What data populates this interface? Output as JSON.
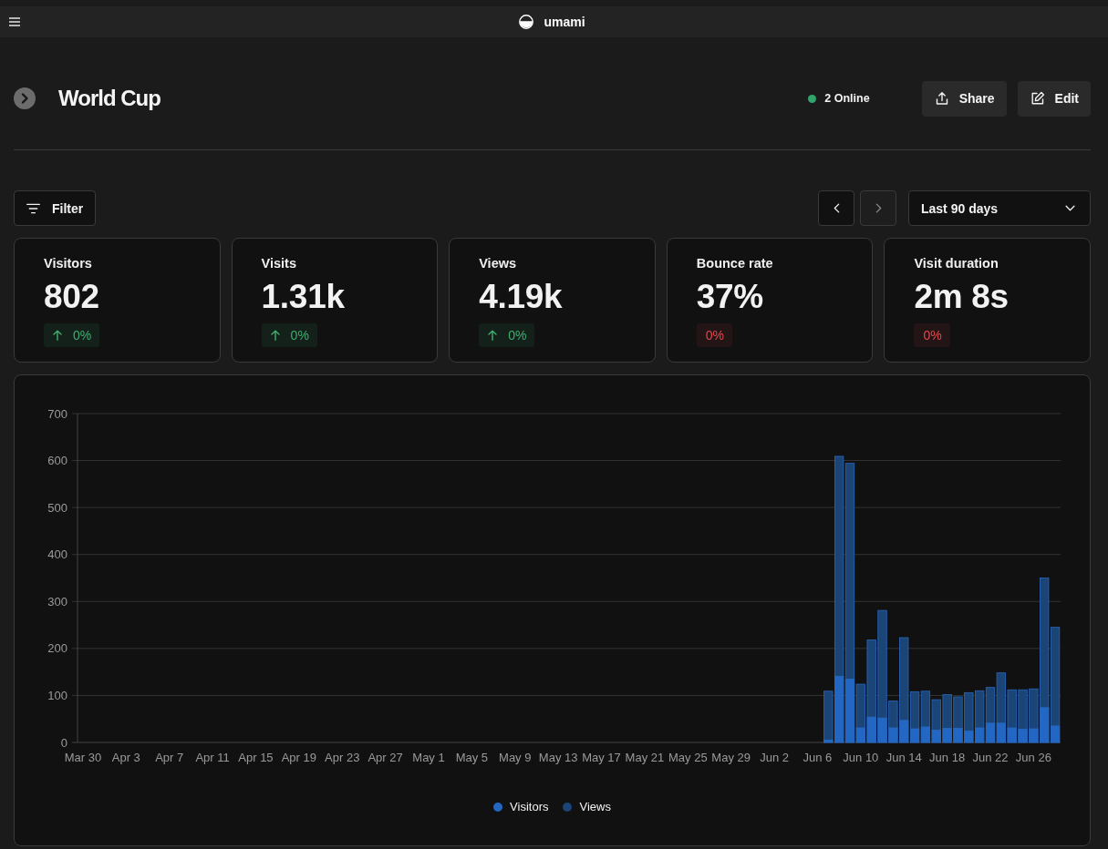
{
  "top_bar": {
    "brand": "umami"
  },
  "header": {
    "title": "World Cup",
    "online": "2 Online",
    "actions": [
      {
        "kind": "share",
        "label": "Share"
      },
      {
        "kind": "edit",
        "label": "Edit"
      }
    ]
  },
  "toolbar": {
    "filter": "Filter",
    "date_nav": [
      {
        "kind": "prev",
        "disabled": false
      },
      {
        "kind": "next",
        "disabled": true
      }
    ],
    "date_range": "Last 90 days"
  },
  "stats": [
    {
      "label": "Visitors",
      "value": "802",
      "change": {
        "text": "0%",
        "positive": true,
        "arrow_up": true
      }
    },
    {
      "label": "Visits",
      "value": "1.31k",
      "change": {
        "text": "0%",
        "positive": true,
        "arrow_up": true
      }
    },
    {
      "label": "Views",
      "value": "4.19k",
      "change": {
        "text": "0%",
        "positive": true,
        "arrow_up": true
      }
    },
    {
      "label": "Bounce rate",
      "value": "37%",
      "change": {
        "text": "0%",
        "positive": false,
        "arrow_up": false
      }
    },
    {
      "label": "Visit duration",
      "value": "2m 8s",
      "change": {
        "text": "0%",
        "positive": false,
        "arrow_up": false
      }
    }
  ],
  "chart": {
    "chart_data": {
      "type": "bar",
      "categories": [
        "Mar 30",
        null,
        null,
        null,
        "Apr 3",
        null,
        null,
        null,
        "Apr 7",
        null,
        null,
        null,
        "Apr 11",
        null,
        null,
        null,
        "Apr 15",
        null,
        null,
        null,
        "Apr 19",
        null,
        null,
        null,
        "Apr 23",
        null,
        null,
        null,
        "Apr 27",
        null,
        null,
        null,
        "May 1",
        null,
        null,
        null,
        "May 5",
        null,
        null,
        null,
        "May 9",
        null,
        null,
        null,
        "May 13",
        null,
        null,
        null,
        "May 17",
        null,
        null,
        null,
        "May 21",
        null,
        null,
        null,
        "May 25",
        null,
        null,
        null,
        "May 29",
        null,
        null,
        null,
        "Jun 2",
        null,
        null,
        null,
        "Jun 6",
        null,
        null,
        null,
        "Jun 10",
        null,
        null,
        null,
        "Jun 14",
        null,
        null,
        null,
        "Jun 18",
        null,
        null,
        null,
        "Jun 22",
        null,
        null,
        null,
        "Jun 26",
        null,
        null
      ],
      "series": [
        {
          "name": "Visitors",
          "color": "#2267c4",
          "values": [
            0,
            0,
            0,
            0,
            0,
            0,
            0,
            0,
            0,
            0,
            0,
            0,
            0,
            0,
            0,
            0,
            0,
            0,
            0,
            0,
            0,
            0,
            0,
            0,
            0,
            0,
            0,
            0,
            0,
            0,
            0,
            0,
            0,
            0,
            0,
            0,
            0,
            0,
            0,
            0,
            0,
            0,
            0,
            0,
            0,
            0,
            0,
            0,
            0,
            0,
            0,
            0,
            0,
            0,
            0,
            0,
            0,
            0,
            0,
            0,
            0,
            0,
            0,
            0,
            0,
            0,
            0,
            0,
            0,
            5,
            141,
            135,
            31,
            54,
            52,
            31,
            47,
            29,
            33,
            26,
            30,
            30,
            24,
            31,
            41,
            41,
            31,
            28,
            29,
            74,
            35
          ]
        },
        {
          "name": "Views",
          "color": "#1b4477",
          "values": [
            0,
            0,
            0,
            0,
            0,
            0,
            0,
            0,
            0,
            0,
            0,
            0,
            0,
            0,
            0,
            0,
            0,
            0,
            0,
            0,
            0,
            0,
            0,
            0,
            0,
            0,
            0,
            0,
            0,
            0,
            0,
            0,
            0,
            0,
            0,
            0,
            0,
            0,
            0,
            0,
            0,
            0,
            0,
            0,
            0,
            0,
            0,
            0,
            0,
            0,
            0,
            0,
            0,
            0,
            0,
            0,
            0,
            0,
            0,
            0,
            0,
            0,
            0,
            0,
            0,
            0,
            0,
            0,
            0,
            109,
            609,
            594,
            124,
            218,
            281,
            88,
            223,
            108,
            109,
            91,
            102,
            97,
            106,
            110,
            117,
            148,
            112,
            112,
            114,
            350,
            245
          ]
        }
      ],
      "ylim": [
        0,
        700
      ],
      "yticks": [
        0,
        100,
        200,
        300,
        400,
        500,
        600,
        700
      ],
      "stacked": false,
      "grid": true,
      "legend": "bottom"
    }
  }
}
